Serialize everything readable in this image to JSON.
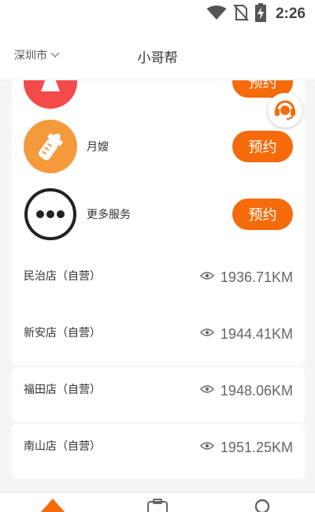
{
  "status": {
    "time": "2:26"
  },
  "header": {
    "city": "深圳市",
    "title": "小哥帮"
  },
  "services": [
    {
      "name": "",
      "button": "预约",
      "icon": "cleaning-icon",
      "color": "#f44a4a"
    },
    {
      "name": "月嫂",
      "button": "预约",
      "icon": "baby-bottle-icon",
      "color": "#f59a3c"
    },
    {
      "name": "更多服务",
      "button": "预约",
      "icon": "more-dots-icon",
      "color": "#222222"
    }
  ],
  "stores": [
    {
      "name": "民治店（自营）",
      "distance": "1936.71KM"
    },
    {
      "name": "新安店（自营）",
      "distance": "1944.41KM"
    },
    {
      "name": "福田店（自营）",
      "distance": "1948.06KM"
    },
    {
      "name": "南山店（自营）",
      "distance": "1951.25KM"
    }
  ],
  "tabs": [
    {
      "icon": "home-icon"
    },
    {
      "icon": "orders-icon"
    },
    {
      "icon": "search-icon"
    }
  ],
  "colors": {
    "accent": "#f56b0c"
  }
}
